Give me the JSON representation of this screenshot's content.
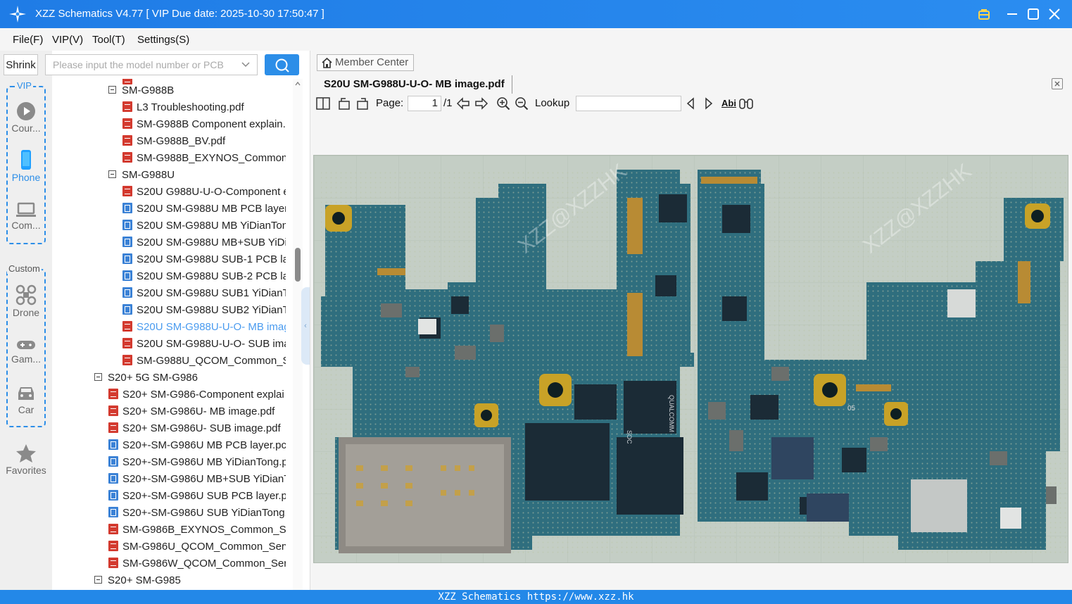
{
  "window": {
    "title": "XZZ Schematics V4.77 [ VIP Due date: 2025-10-30 17:50:47 ]"
  },
  "menu": [
    "File(F)",
    "VIP(V)",
    "Tool(T)",
    "Settings(S)"
  ],
  "sidebar": {
    "shrink_label": "Shrink",
    "vip_title": "VIP",
    "vip_items": [
      {
        "label": "Cour...",
        "icon": "play-icon"
      },
      {
        "label": "Phone",
        "icon": "phone-icon"
      },
      {
        "label": "Com...",
        "icon": "laptop-icon"
      }
    ],
    "custom_title": "Custom",
    "custom_items": [
      {
        "label": "Drone",
        "icon": "drone-icon"
      },
      {
        "label": "Gam...",
        "icon": "gamepad-icon"
      },
      {
        "label": "Car",
        "icon": "car-icon"
      }
    ],
    "favorites_label": "Favorites"
  },
  "search": {
    "placeholder": "Please input the model number or PCB"
  },
  "tree": [
    {
      "type": "folder",
      "label": "SM-G988B"
    },
    {
      "type": "pdf",
      "label": "L3 Troubleshooting.pdf"
    },
    {
      "type": "pdf",
      "label": "SM-G988B Component explain."
    },
    {
      "type": "pdf",
      "label": "SM-G988B_BV.pdf"
    },
    {
      "type": "pdf",
      "label": "SM-G988B_EXYNOS_Common_S"
    },
    {
      "type": "folder",
      "label": "SM-G988U"
    },
    {
      "type": "pdf",
      "label": "S20U G988U-U-O-Component e"
    },
    {
      "type": "pcb",
      "label": "S20U SM-G988U MB PCB layer.p"
    },
    {
      "type": "pcb",
      "label": "S20U SM-G988U MB YiDianTon"
    },
    {
      "type": "pcb",
      "label": "S20U SM-G988U MB+SUB YiDia"
    },
    {
      "type": "pcb",
      "label": "S20U SM-G988U SUB-1 PCB lay"
    },
    {
      "type": "pcb",
      "label": "S20U SM-G988U SUB-2 PCB lay"
    },
    {
      "type": "pcb",
      "label": "S20U SM-G988U SUB1 YiDianTo"
    },
    {
      "type": "pcb",
      "label": "S20U SM-G988U SUB2 YiDianTo"
    },
    {
      "type": "pdf",
      "label": "S20U SM-G988U-U-O- MB imag",
      "selected": true
    },
    {
      "type": "pdf",
      "label": "S20U SM-G988U-U-O- SUB imag"
    },
    {
      "type": "pdf",
      "label": "SM-G988U_QCOM_Common_Se"
    },
    {
      "type": "folder",
      "label": "S20+ 5G SM-G986"
    },
    {
      "type": "pdf",
      "label": "S20+ SM-G986-Component explai"
    },
    {
      "type": "pdf",
      "label": "S20+ SM-G986U- MB image.pdf"
    },
    {
      "type": "pdf",
      "label": "S20+ SM-G986U- SUB image.pdf"
    },
    {
      "type": "pcb",
      "label": "S20+-SM-G986U MB PCB layer.pcb"
    },
    {
      "type": "pcb",
      "label": "S20+-SM-G986U MB YiDianTong.p"
    },
    {
      "type": "pcb",
      "label": "S20+-SM-G986U MB+SUB YiDianT"
    },
    {
      "type": "pcb",
      "label": "S20+-SM-G986U SUB PCB layer.pcb"
    },
    {
      "type": "pcb",
      "label": "S20+-SM-G986U SUB YiDianTong.p"
    },
    {
      "type": "pdf",
      "label": "SM-G986B_EXYNOS_Common_Serv"
    },
    {
      "type": "pdf",
      "label": "SM-G986U_QCOM_Common_Servi"
    },
    {
      "type": "pdf",
      "label": "SM-G986W_QCOM_Common_Servi"
    },
    {
      "type": "folder",
      "label": "S20+ SM-G985"
    }
  ],
  "viewer": {
    "member_center_label": "Member Center",
    "tab_title": "S20U SM-G988U-U-O- MB image.pdf",
    "page_label": "Page:",
    "page_current": "1",
    "page_total": "/1",
    "lookup_label": "Lookup",
    "lookup_value": "",
    "find_case_label": "Abi",
    "watermarks": [
      "XZZ@XZZHK",
      "XZZ@XZZHK"
    ],
    "board_markings": [
      "05",
      "SOC",
      "QUALCOMM"
    ]
  },
  "statusbar": {
    "text": "XZZ Schematics https://www.xzz.hk"
  },
  "colors": {
    "titlebar": "#2388e8",
    "accent": "#2c8ee8",
    "selected_item": "#4a9bef",
    "pcb_board": "#2f6e7e",
    "viewer_background": "#c4cec5"
  }
}
